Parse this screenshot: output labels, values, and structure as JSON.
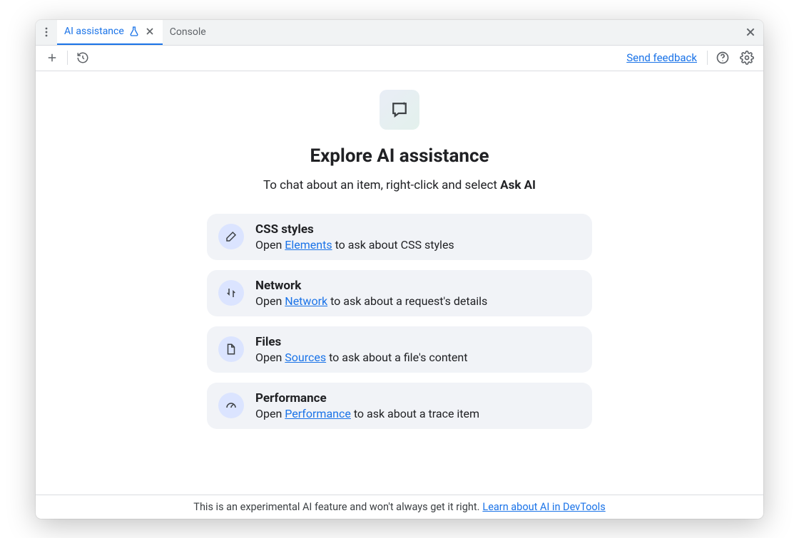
{
  "tabs": {
    "ai_assistance": "AI assistance",
    "console": "Console"
  },
  "toolbar": {
    "feedback": "Send feedback"
  },
  "hero": {
    "title": "Explore AI assistance",
    "subtitle_prefix": "To chat about an item, right-click and select ",
    "subtitle_bold": "Ask AI"
  },
  "cards": [
    {
      "icon": "brush-icon",
      "title": "CSS styles",
      "pre": "Open ",
      "link": "Elements",
      "post": " to ask about CSS styles"
    },
    {
      "icon": "network-icon",
      "title": "Network",
      "pre": "Open ",
      "link": "Network",
      "post": " to ask about a request's details"
    },
    {
      "icon": "file-icon",
      "title": "Files",
      "pre": "Open ",
      "link": "Sources",
      "post": " to ask about a file's content"
    },
    {
      "icon": "gauge-icon",
      "title": "Performance",
      "pre": "Open ",
      "link": "Performance",
      "post": " to ask about a trace item"
    }
  ],
  "footer": {
    "text": "This is an experimental AI feature and won't always get it right. ",
    "link": "Learn about AI in DevTools"
  }
}
